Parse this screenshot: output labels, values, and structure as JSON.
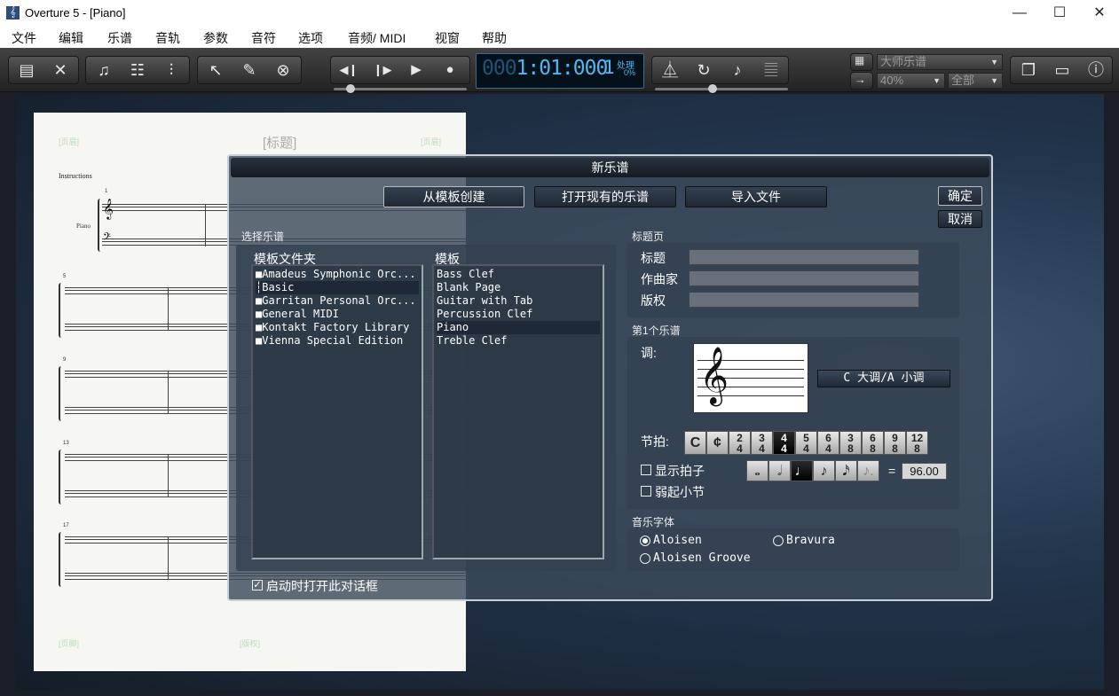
{
  "window": {
    "title": "Overture 5 - [Piano]",
    "icon": "music-app-icon",
    "minimize": "—",
    "maximize": "☐",
    "close": "✕"
  },
  "menu": [
    "文件",
    "编辑",
    "乐谱",
    "音轨",
    "参数",
    "音符",
    "选项",
    "音频/ MIDI",
    "视窗",
    "帮助"
  ],
  "toolbar": {
    "counter_dim": "000",
    "counter": "1:01:000",
    "counter_beat": "1",
    "status": "处理",
    "status_pct": "0%",
    "view_mode": "大师乐谱",
    "zoom": "40%",
    "scope": "全部"
  },
  "score_page": {
    "header_left": "[页眉]",
    "title": "[标题]",
    "header_right": "[页眉]",
    "instructions": "Instructions",
    "part_name": "Piano",
    "footer_left": "[页脚]",
    "footer_center": "[版权]",
    "measure_numbers": [
      "1",
      "5",
      "9",
      "13",
      "17"
    ]
  },
  "dialog": {
    "title": "新乐谱",
    "tabs": {
      "from_template": "从模板创建",
      "open_existing": "打开现有的乐谱",
      "import_file": "导入文件"
    },
    "ok": "确定",
    "cancel": "取消",
    "select_score": {
      "heading": "选择乐谱",
      "folders_label": "模板文件夹",
      "templates_label": "模板",
      "folders": [
        "Amadeus Symphonic Orc...",
        "Basic",
        "Garritan Personal Orc...",
        "General MIDI",
        "Kontakt Factory Library",
        "Vienna Special Edition"
      ],
      "selected_folder": 1,
      "templates": [
        "Bass Clef",
        "Blank Page",
        "Guitar with Tab",
        "Percussion Clef",
        "Piano",
        "Treble Clef"
      ],
      "selected_template": 4,
      "show_on_startup": "启动时打开此对话框",
      "show_on_startup_checked": true
    },
    "title_page": {
      "heading": "标题页",
      "title_label": "标题",
      "composer_label": "作曲家",
      "copyright_label": "版权",
      "title_value": "",
      "composer_value": "",
      "copyright_value": ""
    },
    "first_staff": {
      "heading": "第1个乐谱",
      "key_label": "调:",
      "key_value": "C 大调/A 小调",
      "meter_label": "节拍:",
      "meters": [
        "C",
        "¢",
        "2/4",
        "3/4",
        "4/4",
        "5/4",
        "6/4",
        "3/8",
        "6/8",
        "9/8",
        "12/8"
      ],
      "selected_meter": 4,
      "show_beats": "显示拍子",
      "pickup_bar": "弱起小节",
      "note_values": [
        "𝅝",
        "𝅗𝅥",
        "♩",
        "♪",
        "𝅘𝅥𝅯",
        "♪."
      ],
      "selected_note": 2,
      "equals": "=",
      "tempo": "96.00"
    },
    "music_font": {
      "heading": "音乐字体",
      "options": [
        "Aloisen",
        "Bravura",
        "Aloisen Groove"
      ],
      "selected": 0
    }
  }
}
